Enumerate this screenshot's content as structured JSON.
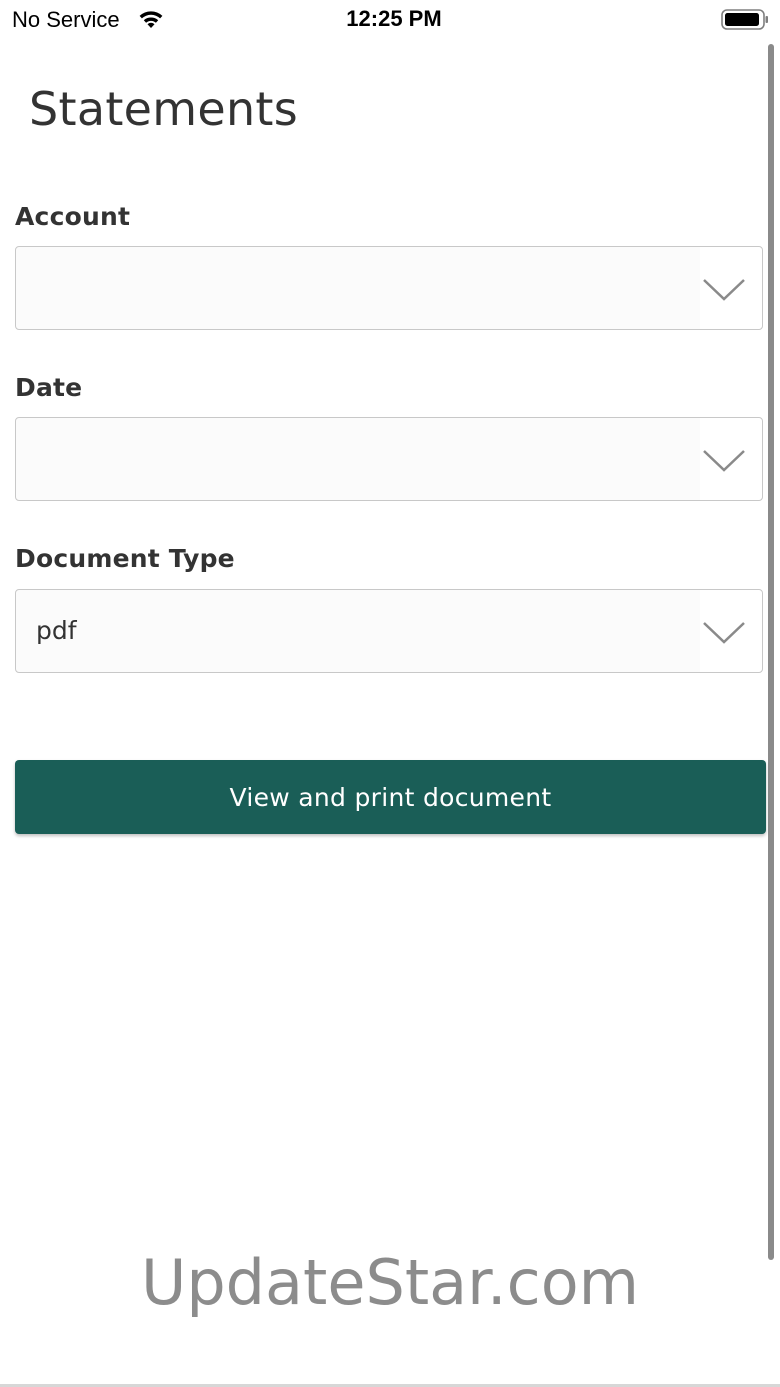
{
  "status_bar": {
    "carrier": "No Service",
    "time": "12:25 PM",
    "wifi_icon": "wifi-icon",
    "battery_icon": "battery-icon"
  },
  "page": {
    "title": "Statements"
  },
  "form": {
    "account": {
      "label": "Account",
      "value": ""
    },
    "date": {
      "label": "Date",
      "value": ""
    },
    "document_type": {
      "label": "Document Type",
      "value": "pdf"
    },
    "submit_label": "View and print document"
  },
  "watermark": "UpdateStar.com",
  "colors": {
    "primary_button": "#1a5e57",
    "text": "#333333",
    "border": "#c8c8c8"
  }
}
